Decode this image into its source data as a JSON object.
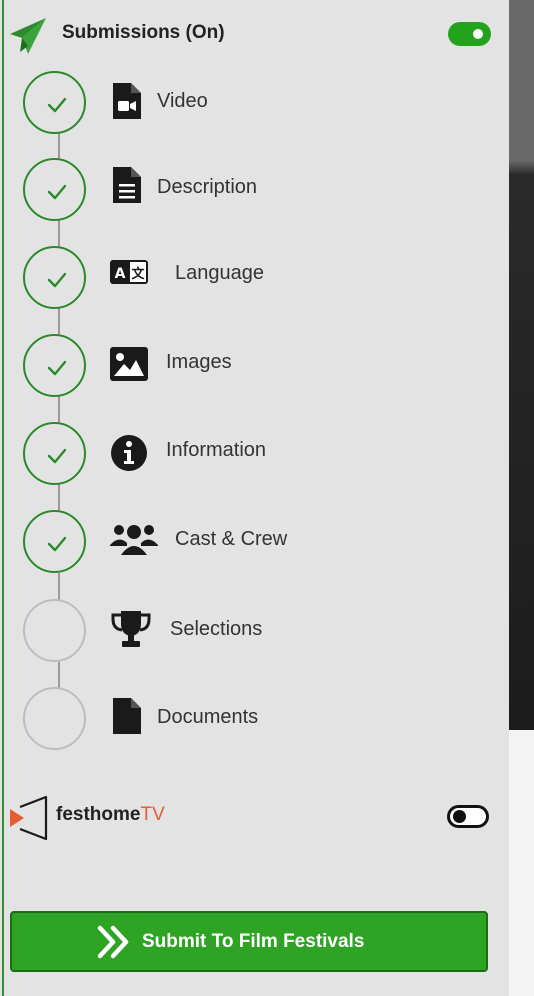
{
  "header": {
    "title": "Submissions (On)",
    "icon": "paper-plane-icon",
    "toggle_state": "on"
  },
  "steps": [
    {
      "label": "Video",
      "icon": "video-file-icon",
      "completed": true
    },
    {
      "label": "Description",
      "icon": "document-lines-icon",
      "completed": true
    },
    {
      "label": "Language",
      "icon": "translate-icon",
      "completed": true
    },
    {
      "label": "Images",
      "icon": "image-icon",
      "completed": true
    },
    {
      "label": "Information",
      "icon": "info-circle-icon",
      "completed": true
    },
    {
      "label": "Cast & Crew",
      "icon": "users-icon",
      "completed": true
    },
    {
      "label": "Selections",
      "icon": "trophy-icon",
      "completed": false
    },
    {
      "label": "Documents",
      "icon": "file-icon",
      "completed": false
    }
  ],
  "festhome_tv": {
    "label_main": "festhome",
    "label_accent": "TV",
    "toggle_state": "off"
  },
  "submit": {
    "label": "Submit To Film Festivals",
    "icon": "double-chevron-right-icon"
  },
  "colors": {
    "accent_green": "#2ea324",
    "check_green": "#2a8a2a",
    "tv_orange": "#e85c33",
    "panel_bg": "#e3e3e3"
  }
}
